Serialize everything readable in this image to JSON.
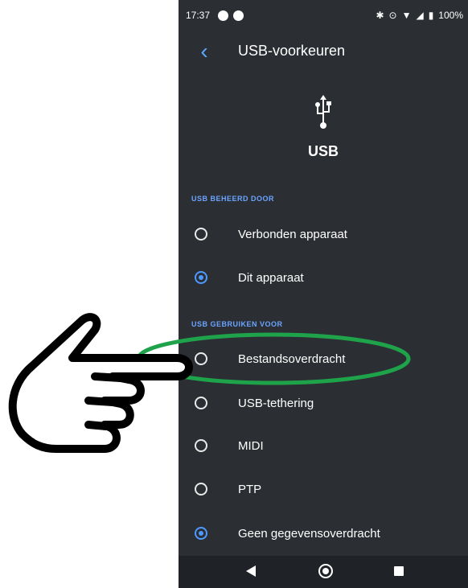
{
  "status": {
    "time": "17:37",
    "battery": "100%"
  },
  "appbar": {
    "title": "USB-voorkeuren"
  },
  "header": {
    "title": "USB"
  },
  "sections": {
    "managed_by": {
      "label": "USB BEHEERD DOOR",
      "options": [
        {
          "label": "Verbonden apparaat",
          "selected": false
        },
        {
          "label": "Dit apparaat",
          "selected": true
        }
      ]
    },
    "use_for": {
      "label": "USB GEBRUIKEN VOOR",
      "options": [
        {
          "label": "Bestandsoverdracht",
          "selected": false
        },
        {
          "label": "USB-tethering",
          "selected": false
        },
        {
          "label": "MIDI",
          "selected": false
        },
        {
          "label": "PTP",
          "selected": false
        },
        {
          "label": "Geen gegevensoverdracht",
          "selected": true
        }
      ]
    }
  },
  "colors": {
    "accent": "#4f98ff",
    "highlight": "#1fa34a"
  },
  "icons": [
    "back-arrow-icon",
    "usb-icon",
    "bluetooth-icon",
    "location-icon",
    "wifi-icon",
    "signal-icon",
    "battery-icon",
    "pointing-hand-icon"
  ]
}
